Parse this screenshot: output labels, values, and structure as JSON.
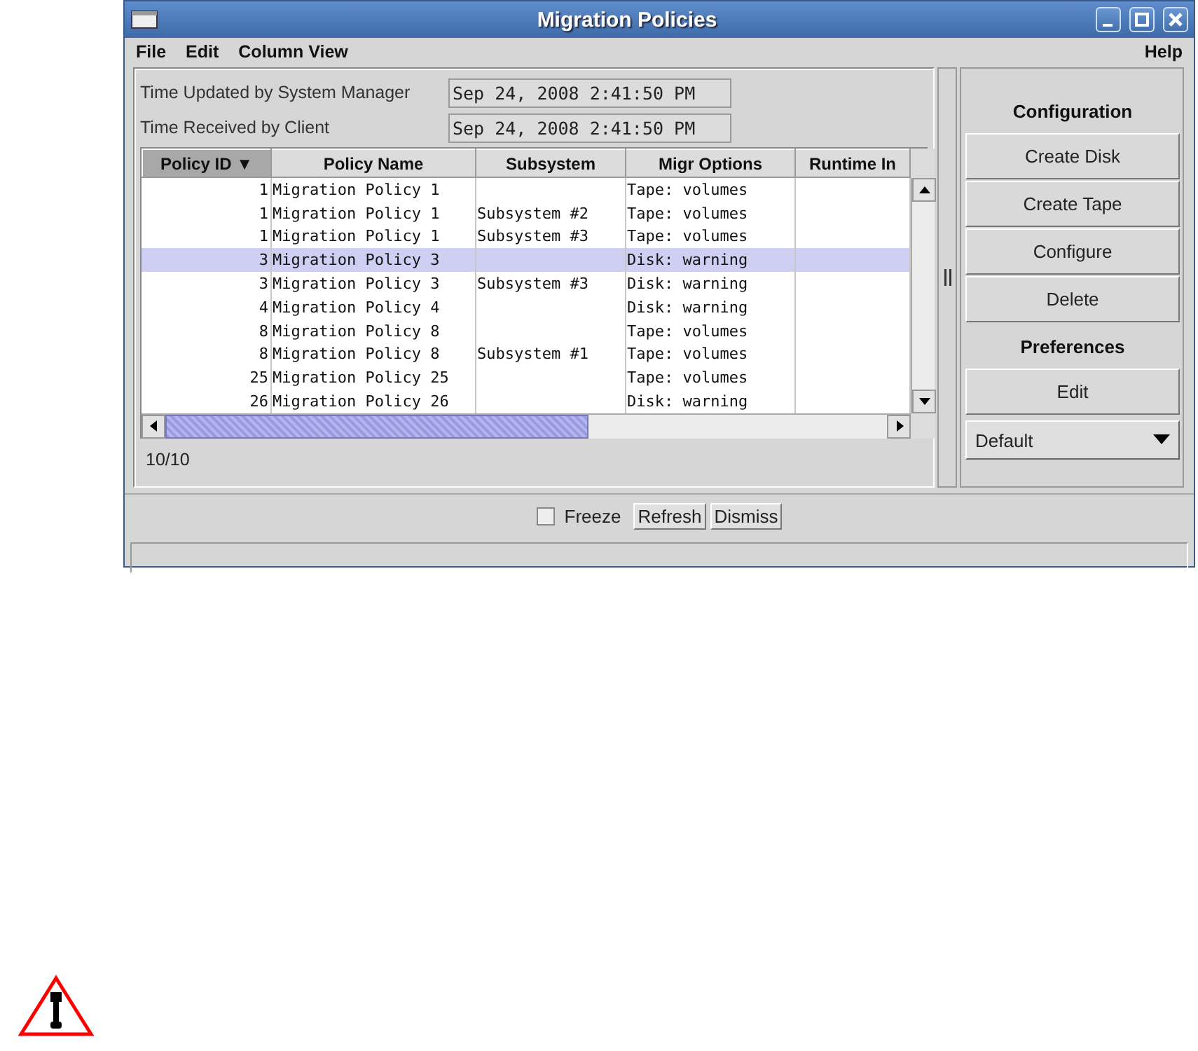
{
  "window": {
    "title": "Migration Policies"
  },
  "menu_bar": {
    "left": [
      "File",
      "Edit",
      "Column View"
    ],
    "right": [
      "Help"
    ]
  },
  "times": [
    {
      "label": "Time Updated by System Manager",
      "value": "Sep 24, 2008 2:41:50 PM"
    },
    {
      "label": "Time Received by Client",
      "value": "Sep 24, 2008 2:41:50 PM"
    }
  ],
  "table": {
    "columns": [
      {
        "label": "Policy ID ▼",
        "sorted": true
      },
      {
        "label": "Policy Name",
        "sorted": false
      },
      {
        "label": "Subsystem",
        "sorted": false
      },
      {
        "label": "Migr Options",
        "sorted": false
      },
      {
        "label": "Runtime In",
        "sorted": false
      }
    ],
    "rows": [
      {
        "cells": [
          "1",
          "Migration Policy 1",
          "",
          "Tape: volumes",
          ""
        ],
        "selected": false
      },
      {
        "cells": [
          "1",
          "Migration Policy 1",
          "Subsystem #2",
          "Tape: volumes",
          ""
        ],
        "selected": false
      },
      {
        "cells": [
          "1",
          "Migration Policy 1",
          "Subsystem #3",
          "Tape: volumes",
          ""
        ],
        "selected": false
      },
      {
        "cells": [
          "3",
          "Migration Policy 3",
          "",
          "Disk: warning",
          ""
        ],
        "selected": true
      },
      {
        "cells": [
          "3",
          "Migration Policy 3",
          "Subsystem #3",
          "Disk: warning",
          ""
        ],
        "selected": false
      },
      {
        "cells": [
          "4",
          "Migration Policy 4",
          "",
          "Disk: warning",
          ""
        ],
        "selected": false
      },
      {
        "cells": [
          "8",
          "Migration Policy 8",
          "",
          "Tape: volumes",
          ""
        ],
        "selected": false
      },
      {
        "cells": [
          "8",
          "Migration Policy 8",
          "Subsystem #1",
          "Tape: volumes",
          ""
        ],
        "selected": false
      },
      {
        "cells": [
          "25",
          "Migration Policy 25",
          "",
          "Tape: volumes",
          ""
        ],
        "selected": false
      },
      {
        "cells": [
          "26",
          "Migration Policy 26",
          "",
          "Disk: warning",
          ""
        ],
        "selected": false
      }
    ],
    "row_count": "10/10"
  },
  "side_panel": [
    {
      "kind": "heading",
      "label": "Configuration"
    },
    {
      "kind": "button",
      "label": "Create Disk"
    },
    {
      "kind": "button",
      "label": "Create Tape"
    },
    {
      "kind": "button",
      "label": "Configure"
    },
    {
      "kind": "button",
      "label": "Delete"
    },
    {
      "kind": "heading",
      "label": "Preferences"
    },
    {
      "kind": "button",
      "label": "Edit"
    },
    {
      "kind": "dropdown",
      "label": "Default"
    }
  ],
  "bottom_bar": {
    "freeze": {
      "label": "Freeze",
      "checked": false
    },
    "buttons": [
      "Refresh",
      "Dismiss"
    ]
  }
}
